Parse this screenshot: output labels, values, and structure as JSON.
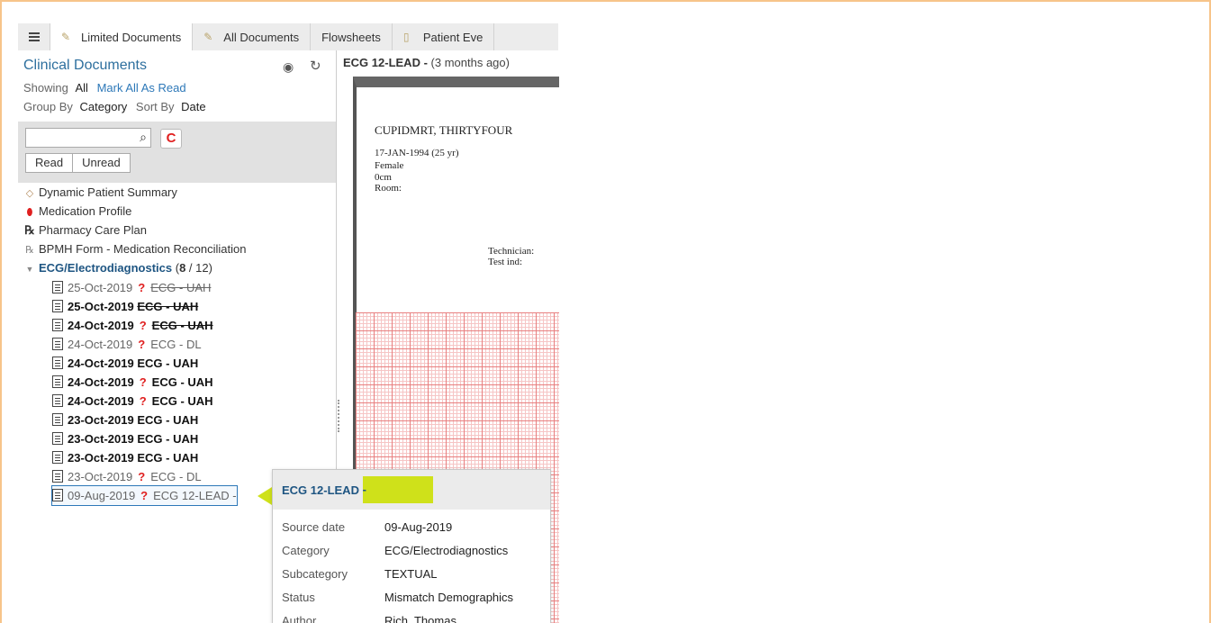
{
  "tabs": [
    {
      "label": "Limited Documents",
      "icon": "document-icon",
      "active": true
    },
    {
      "label": "All Documents",
      "icon": "documents-icon",
      "active": false
    },
    {
      "label": "Flowsheets",
      "icon": "",
      "active": false
    },
    {
      "label": "Patient Eve",
      "icon": "event-icon",
      "active": false
    }
  ],
  "panel": {
    "title": "Clinical Documents",
    "showing_label": "Showing",
    "showing_value": "All",
    "mark_all": "Mark All As Read",
    "group_by_label": "Group By",
    "group_by_value": "Category",
    "sort_by_label": "Sort By",
    "sort_by_value": "Date"
  },
  "filter": {
    "search_placeholder": "",
    "clear_label": "C",
    "read_label": "Read",
    "unread_label": "Unread"
  },
  "tree": {
    "items": [
      {
        "label": "Dynamic Patient Summary",
        "icon": "summary-icon"
      },
      {
        "label": "Medication Profile",
        "icon": "pill-icon"
      },
      {
        "label": "Pharmacy Care Plan",
        "icon": "rx-icon"
      },
      {
        "label": "BPMH Form - Medication Reconciliation",
        "icon": "rx-list-icon"
      }
    ],
    "category": {
      "label": "ECG/Electrodiagnostics",
      "unread": "8",
      "total": "12",
      "sep": "/"
    },
    "docs": [
      {
        "date": "25-Oct-2019",
        "name": "ECG - UAH",
        "bold": false,
        "flag": true,
        "strike": true
      },
      {
        "date": "25-Oct-2019",
        "name": "ECG - UAH",
        "bold": true,
        "flag": false,
        "strike": true
      },
      {
        "date": "24-Oct-2019",
        "name": "ECG - UAH",
        "bold": true,
        "flag": true,
        "strike": true
      },
      {
        "date": "24-Oct-2019",
        "name": "ECG - DL",
        "bold": false,
        "flag": true,
        "strike": false
      },
      {
        "date": "24-Oct-2019",
        "name": "ECG - UAH",
        "bold": true,
        "flag": false,
        "strike": false
      },
      {
        "date": "24-Oct-2019",
        "name": "ECG - UAH",
        "bold": true,
        "flag": true,
        "strike": false
      },
      {
        "date": "24-Oct-2019",
        "name": "ECG - UAH",
        "bold": true,
        "flag": true,
        "strike": false
      },
      {
        "date": "23-Oct-2019",
        "name": "ECG - UAH",
        "bold": true,
        "flag": false,
        "strike": false
      },
      {
        "date": "23-Oct-2019",
        "name": "ECG - UAH",
        "bold": true,
        "flag": false,
        "strike": false
      },
      {
        "date": "23-Oct-2019",
        "name": "ECG - UAH",
        "bold": true,
        "flag": false,
        "strike": false
      },
      {
        "date": "23-Oct-2019",
        "name": "ECG - DL",
        "bold": false,
        "flag": true,
        "strike": false
      },
      {
        "date": "09-Aug-2019",
        "name": "ECG 12-LEAD -",
        "bold": false,
        "flag": true,
        "strike": false,
        "selected": true
      }
    ]
  },
  "viewer": {
    "title": "ECG 12-LEAD -",
    "age": "(3 months ago)",
    "patient_name": "CUPIDMRT, THIRTYFOUR",
    "dob": "17-JAN-1994 (25 yr)",
    "sex": "Female",
    "height": "0cm",
    "room": "Room:",
    "technician": "Technician:",
    "test_ind": "Test ind:"
  },
  "tooltip": {
    "title": "ECG 12-LEAD",
    "title_suffix": "-",
    "rows": [
      {
        "key": "Source date",
        "value": "09-Aug-2019"
      },
      {
        "key": "Category",
        "value": "ECG/Electrodiagnostics"
      },
      {
        "key": "Subcategory",
        "value": "TEXTUAL"
      },
      {
        "key": "Status",
        "value": "Mismatch Demographics"
      },
      {
        "key": "Author",
        "value": "Rich, Thomas"
      }
    ]
  },
  "colors": {
    "accent": "#2d6f9e",
    "category": "#1e5582",
    "flag": "#e02020",
    "highlight": "#cfe11a",
    "frame": "#f7c48a"
  }
}
